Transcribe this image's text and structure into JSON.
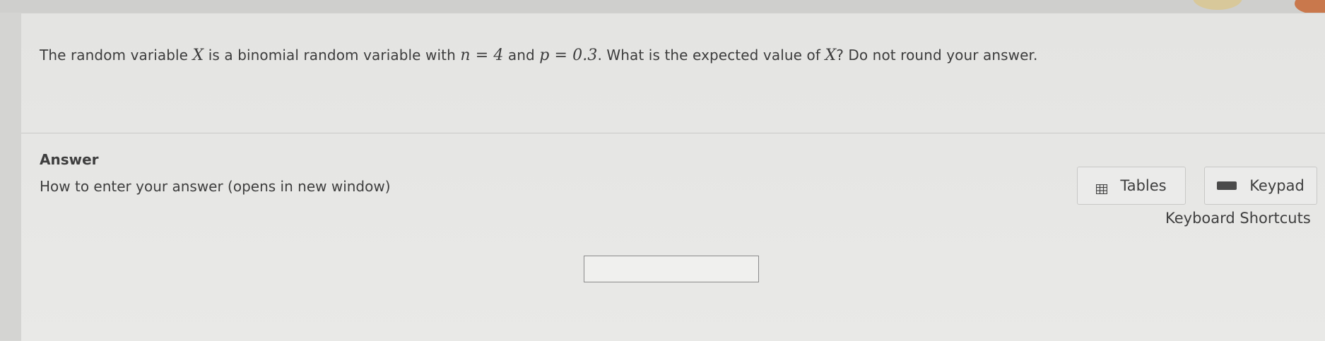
{
  "question": {
    "part1": "The random variable ",
    "var_x": "X",
    "part2": " is a binomial random variable with ",
    "n_expr": "n = 4",
    "part3": " and ",
    "p_expr": "p = 0.3",
    "part4": ". What is the expected value of ",
    "var_x2": "X",
    "part5": "? Do not round your answer."
  },
  "answer": {
    "label": "Answer",
    "help_link": "How to enter your answer (opens in new window)",
    "input_value": ""
  },
  "tools": {
    "tables_label": "Tables",
    "keypad_label": "Keypad",
    "shortcuts_label": "Keyboard Shortcuts"
  }
}
